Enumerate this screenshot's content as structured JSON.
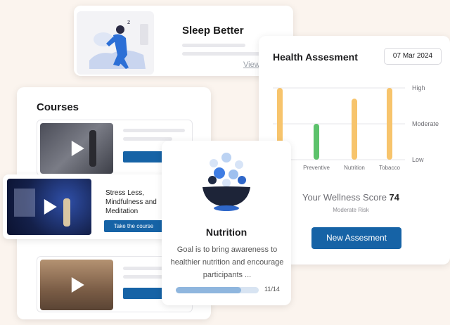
{
  "sleep": {
    "title": "Sleep Better",
    "view_link": "View"
  },
  "courses": {
    "title": "Courses",
    "featured": {
      "title": "Stress Less, Mindfulness and Meditation",
      "button": "Take the course"
    }
  },
  "health": {
    "title": "Health Assesment",
    "date": "07 Mar 2024",
    "chart_data": {
      "type": "bar",
      "categories": [
        "Preventive",
        "Nutrition",
        "Tobacco"
      ],
      "visible_category_labels": [
        "Preventive",
        "Nutrition",
        "Tobacco"
      ],
      "y_levels": [
        "Low",
        "Moderate",
        "High"
      ],
      "series": [
        {
          "values": [
            "High",
            "Moderate",
            "High",
            "High"
          ]
        }
      ],
      "bars": [
        {
          "level": 1.0,
          "color": "#f7c46c"
        },
        {
          "level": 0.5,
          "color": "#5cc26b"
        },
        {
          "level": 0.85,
          "color": "#f7c46c"
        },
        {
          "level": 1.0,
          "color": "#f7c46c"
        }
      ]
    },
    "score_label": "Your Wellness Score",
    "score_value": "74",
    "risk": "Moderate Risk",
    "new_button": "New Assesment"
  },
  "nutrition": {
    "title": "Nutrition",
    "description": "Goal is to bring awareness to healthier nutrition and encourage participants ...",
    "progress_text": "11/14",
    "progress": 0.7857
  },
  "colors": {
    "primary": "#1663a6",
    "bar_orange": "#f7c46c",
    "bar_green": "#5cc26b"
  }
}
